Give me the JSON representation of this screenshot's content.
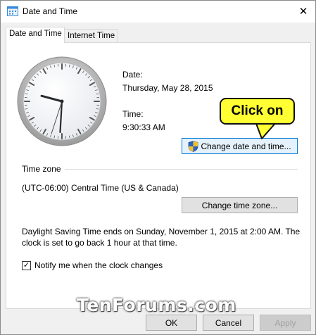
{
  "window": {
    "title": "Date and Time"
  },
  "tabs": [
    {
      "label": "Date and Time",
      "active": true
    },
    {
      "label": "Internet Time",
      "active": false
    }
  ],
  "clock": {
    "hour": 9,
    "minute": 30,
    "second": 33
  },
  "date": {
    "label": "Date:",
    "value": "Thursday, May 28, 2015"
  },
  "time": {
    "label": "Time:",
    "value": "9:30:33 AM"
  },
  "change_datetime_button": {
    "label": "Change date and time...",
    "icon": "uac-shield-icon"
  },
  "callout": {
    "text": "Click on"
  },
  "timezone": {
    "section_label": "Time zone",
    "value": "(UTC-06:00) Central Time (US & Canada)",
    "change_button": "Change time zone..."
  },
  "dst_notice": {
    "line1": "Daylight Saving Time ends on Sunday, November 1, 2015 at 2:00 AM. The",
    "line2": "clock is set to go back 1 hour at that time."
  },
  "notify_checkbox": {
    "label": "Notify me when the clock changes",
    "checked": true
  },
  "footer": {
    "ok": "OK",
    "cancel": "Cancel",
    "apply": "Apply"
  },
  "watermark": "TenForums.com",
  "colors": {
    "accent": "#0078d7",
    "callout": "#ffff33"
  }
}
